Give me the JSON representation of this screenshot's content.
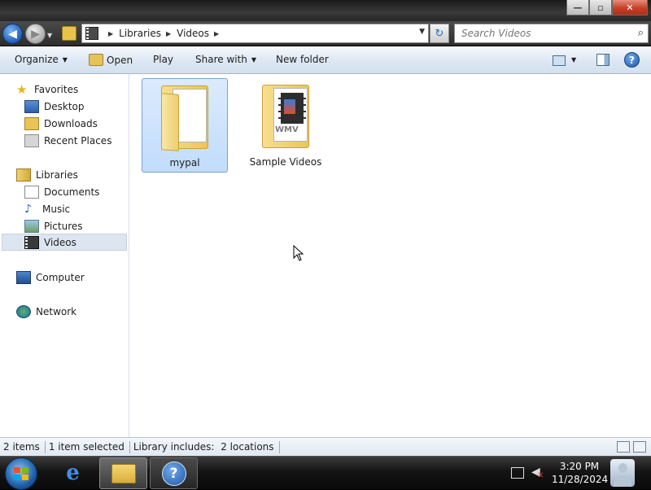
{
  "window": {
    "controls": {
      "minimize": "—",
      "maximize": "▫",
      "close": "✕"
    }
  },
  "address": {
    "breadcrumbs": [
      "Libraries",
      "Videos"
    ],
    "search_placeholder": "Search Videos"
  },
  "toolbar": {
    "organize": "Organize",
    "open": "Open",
    "play": "Play",
    "share_with": "Share with",
    "new_folder": "New folder"
  },
  "nav": {
    "favorites": "Favorites",
    "desktop": "Desktop",
    "downloads": "Downloads",
    "recent_places": "Recent Places",
    "libraries": "Libraries",
    "documents": "Documents",
    "music": "Music",
    "pictures": "Pictures",
    "videos": "Videos",
    "computer": "Computer",
    "network": "Network"
  },
  "items": [
    {
      "name": "mypal",
      "selected": true
    },
    {
      "name": "Sample Videos",
      "selected": false,
      "badge": "WMV"
    }
  ],
  "status": {
    "count": "2 items",
    "selection": "1 item selected",
    "library_label": "Library includes:",
    "library_value": "2 locations"
  },
  "taskbar": {
    "time": "3:20 PM",
    "date": "11/28/2024",
    "help_glyph": "?"
  },
  "colors": {
    "selection": "#cce0fb",
    "selection_border": "#7da2ce",
    "taskbar": "#0a0a0a",
    "accent_blue": "#1f5fb5"
  }
}
